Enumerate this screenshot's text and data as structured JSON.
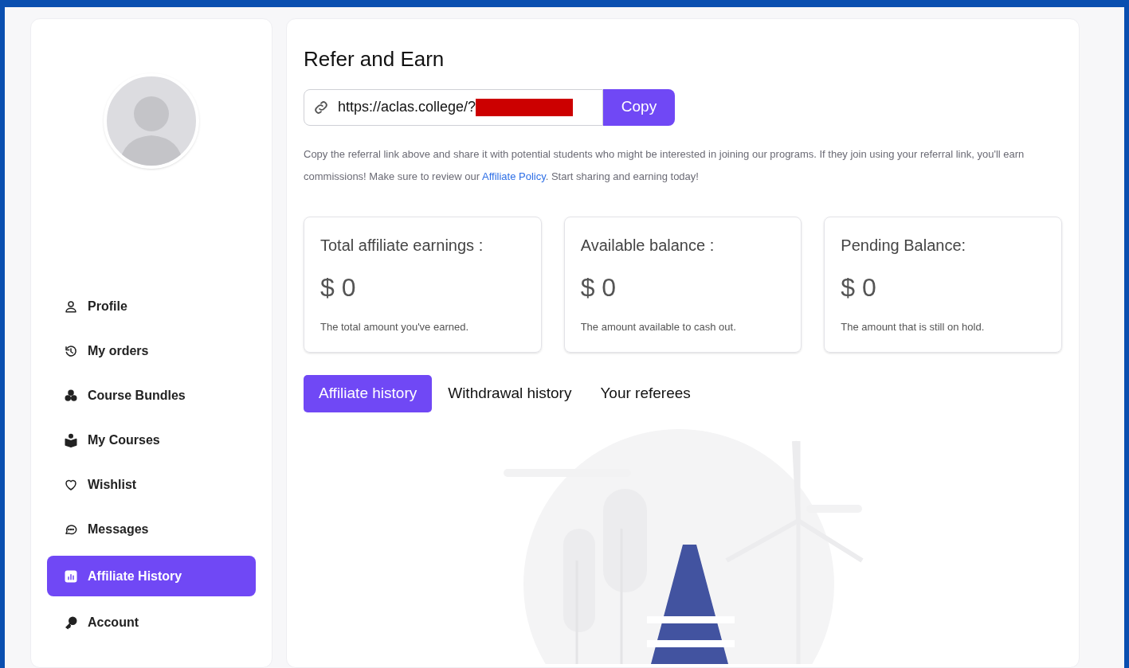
{
  "sidebar": {
    "items": [
      {
        "kind": "profile",
        "label": "Profile",
        "selected": false
      },
      {
        "kind": "orders",
        "label": "My orders",
        "selected": false
      },
      {
        "kind": "bundles",
        "label": "Course Bundles",
        "selected": false
      },
      {
        "kind": "courses",
        "label": "My Courses",
        "selected": false
      },
      {
        "kind": "wishlist",
        "label": "Wishlist",
        "selected": false
      },
      {
        "kind": "messages",
        "label": "Messages",
        "selected": false
      },
      {
        "kind": "affiliate",
        "label": "Affiliate History",
        "selected": true
      },
      {
        "kind": "account",
        "label": "Account",
        "selected": false
      }
    ]
  },
  "main": {
    "title": "Refer and Earn",
    "referral": {
      "value": "https://aclas.college/?",
      "redacted": true,
      "button": "Copy"
    },
    "description": "Copy the referral link above and share it with potential students who might be interested in joining our programs. If they join using your referral link, you'll earn commissions! Make sure to review our ",
    "policy_link": "Affiliate Policy",
    "description_end": ". Start sharing and earning today!",
    "stats": [
      {
        "title": "Total affiliate earnings :",
        "amount": "$ 0",
        "note": "The total amount you've earned."
      },
      {
        "title": "Available balance :",
        "amount": "$ 0",
        "note": "The amount available to cash out."
      },
      {
        "title": "Pending Balance:",
        "amount": "$ 0",
        "note": "The amount that is still on hold."
      }
    ],
    "tabs": [
      {
        "label": "Affiliate history",
        "selected": true
      },
      {
        "label": "Withdrawal history",
        "selected": false
      },
      {
        "label": "Your referees",
        "selected": false
      }
    ]
  }
}
